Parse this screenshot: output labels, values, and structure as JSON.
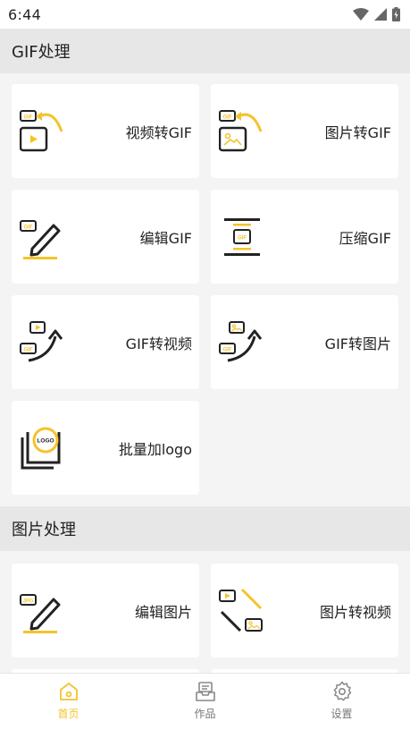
{
  "status_bar": {
    "time": "6:44"
  },
  "sections": [
    {
      "title": "GIF处理"
    },
    {
      "title": "图片处理"
    }
  ],
  "gif_tools": [
    {
      "label": "视频转GIF",
      "icon": "video-to-gif-icon"
    },
    {
      "label": "图片转GIF",
      "icon": "image-to-gif-icon"
    },
    {
      "label": "编辑GIF",
      "icon": "edit-gif-icon"
    },
    {
      "label": "压缩GIF",
      "icon": "compress-gif-icon"
    },
    {
      "label": "GIF转视频",
      "icon": "gif-to-video-icon"
    },
    {
      "label": "GIF转图片",
      "icon": "gif-to-image-icon"
    },
    {
      "label": "批量加logo",
      "icon": "batch-logo-icon"
    }
  ],
  "image_tools": [
    {
      "label": "编辑图片",
      "icon": "edit-image-icon"
    },
    {
      "label": "图片转视频",
      "icon": "image-to-video-icon"
    }
  ],
  "icon_text": {
    "gif": "GIF",
    "jpg": "JPG",
    "logo": "LOGO"
  },
  "nav": [
    {
      "label": "首页",
      "icon": "home-icon",
      "active": true
    },
    {
      "label": "作品",
      "icon": "works-icon",
      "active": false
    },
    {
      "label": "设置",
      "icon": "settings-icon",
      "active": false
    }
  ],
  "colors": {
    "accent": "#f5c32a",
    "dark": "#222222",
    "background": "#f4f4f4"
  }
}
